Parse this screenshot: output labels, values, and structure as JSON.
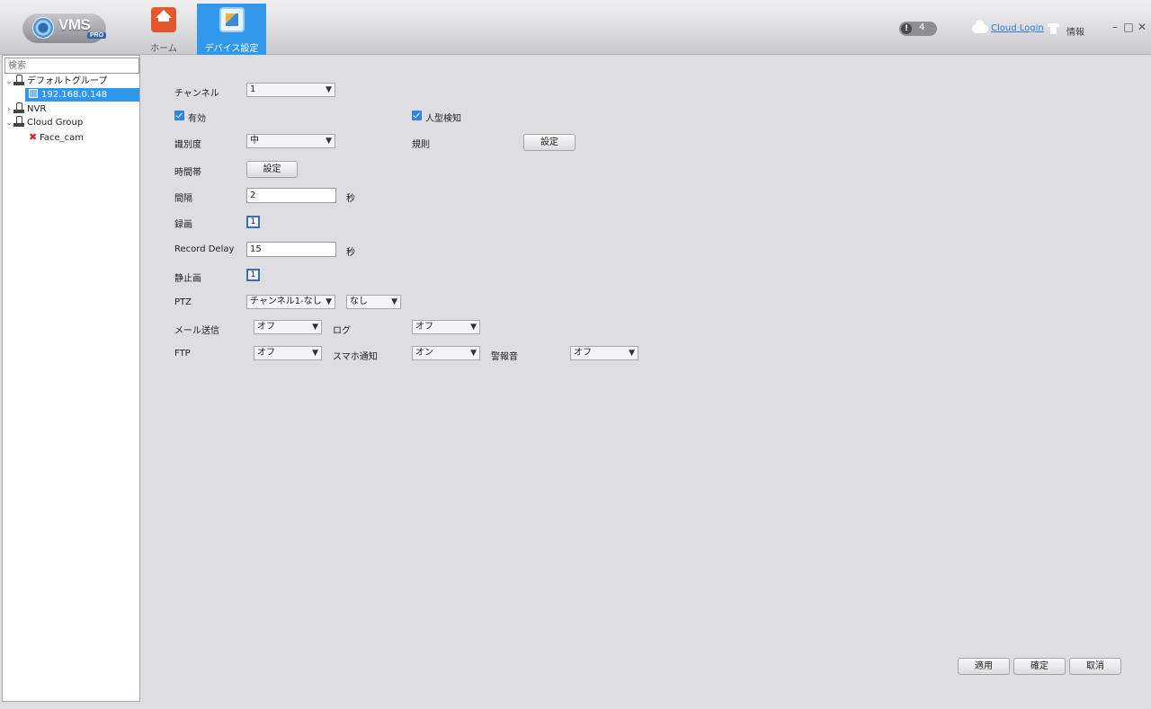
{
  "app": {
    "logo_text": "VMS",
    "logo_sub": "PRO"
  },
  "nav": {
    "home_label": "ホーム",
    "device_label": "デバイス設定"
  },
  "header": {
    "alarm_count": "4",
    "alarm_symbol": "!",
    "cloud_login": "Cloud Login",
    "info_label": "情報",
    "minimize": "–",
    "maximize": "□",
    "close": "✕"
  },
  "sidebar": {
    "search_placeholder": "検索",
    "tree": [
      {
        "label": "デフォルトグループ"
      },
      {
        "label": "192.168.0.148"
      },
      {
        "label": "NVR"
      },
      {
        "label": "Cloud Group"
      },
      {
        "label": "Face_cam"
      }
    ]
  },
  "form": {
    "channel_label": "チャンネル",
    "channel_value": "1",
    "enable_label": "有効",
    "human_detect_label": "人型検知",
    "sensitivity_label": "識別度",
    "sensitivity_value": "中",
    "rule_label": "規則",
    "rule_button": "設定",
    "schedule_label": "時間帯",
    "schedule_button": "設定",
    "interval_label": "間隔",
    "interval_value": "2",
    "interval_unit": "秒",
    "record_label": "録画",
    "record_channel": "1",
    "record_delay_label": "Record Delay",
    "record_delay_value": "15",
    "record_delay_unit": "秒",
    "snapshot_label": "静止画",
    "snapshot_channel": "1",
    "ptz_label": "PTZ",
    "ptz_channel_value": "チャンネル1-なし",
    "ptz_action_value": "なし",
    "email_label": "メール送信",
    "email_value": "オフ",
    "log_label": "ログ",
    "log_value": "オフ",
    "ftp_label": "FTP",
    "ftp_value": "オフ",
    "push_label": "スマホ通知",
    "push_value": "オン",
    "buzzer_label": "警報音",
    "buzzer_value": "オフ"
  },
  "footer": {
    "apply": "適用",
    "ok": "確定",
    "cancel": "取消"
  },
  "icons": {
    "dropdown_arrow": "▼",
    "chevron_expanded": "⌄",
    "chevron_collapsed": "›",
    "offline_mark": "✖"
  }
}
